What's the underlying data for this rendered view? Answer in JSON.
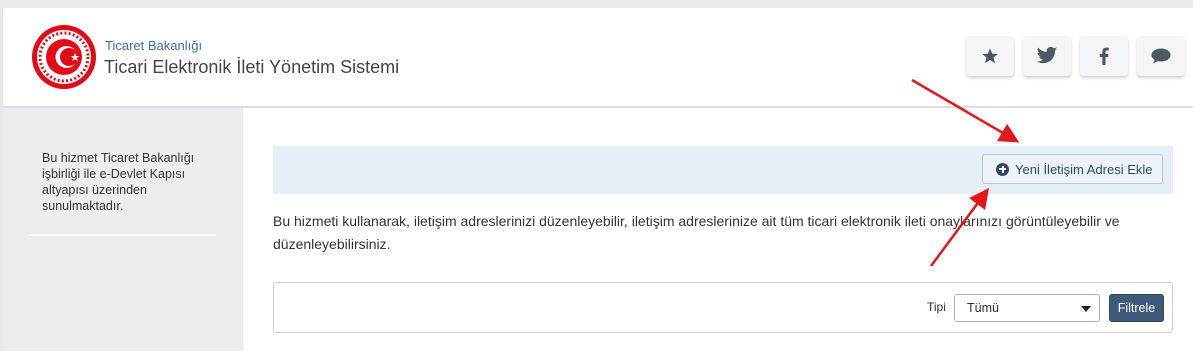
{
  "header": {
    "ministry": "Ticaret Bakanlığı",
    "title": "Ticari Elektronik İleti Yönetim Sistemi"
  },
  "social": [
    {
      "icon": "star-icon"
    },
    {
      "icon": "twitter-icon"
    },
    {
      "icon": "facebook-icon"
    },
    {
      "icon": "chat-icon"
    }
  ],
  "sidebar": {
    "info_text": "Bu hizmet Ticaret Bakanlığı işbirliği ile e-Devlet Kapısı altyapısı üzerinden sunulmaktadır."
  },
  "main": {
    "add_button_label": "Yeni İletişim Adresi Ekle",
    "description": "Bu hizmeti kullanarak, iletişim adreslerinizi düzenleyebilir, iletişim adreslerinize ait tüm ticari elektronik ileti onaylarınızı görüntüleyebilir ve düzenleyebilirsiniz.",
    "filter": {
      "type_label": "Tipi",
      "type_value": "Tümü",
      "filter_button": "Filtrele"
    }
  },
  "colors": {
    "accent": "#3a73b0",
    "button_dark": "#3d5a7a",
    "annotation_arrow": "#e3171b"
  }
}
